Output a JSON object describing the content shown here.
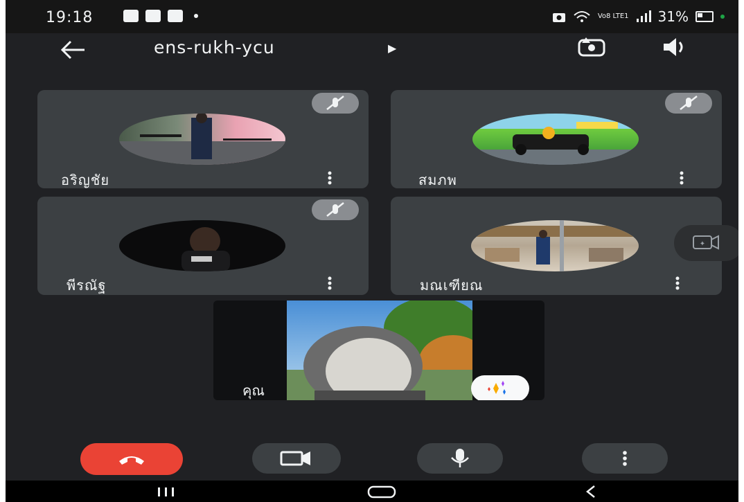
{
  "status_bar": {
    "time": "19:18",
    "right_text": "31%",
    "network": "Vo8 LTE1"
  },
  "top_bar": {
    "meeting_code": "ens-rukh-ycu",
    "back_icon": "arrow-back-icon",
    "switch_camera_icon": "switch-camera-icon",
    "audio_icon": "speaker-icon"
  },
  "participants": [
    {
      "name": "อริญชัย",
      "muted": true
    },
    {
      "name": "สมภพ",
      "muted": true
    },
    {
      "name": "พีรณัฐ",
      "muted": true
    },
    {
      "name": "มณเฑียณ",
      "muted": false
    }
  ],
  "self_view": {
    "label": "คุณ",
    "effects_icon": "sparkle-effects-icon"
  },
  "controls": {
    "end_call_icon": "hang-up-icon",
    "camera_icon": "video-camera-icon",
    "mic_icon": "microphone-icon",
    "more_icon": "more-vert-icon"
  },
  "colors": {
    "background": "#202124",
    "tile": "#3c4043",
    "end_call": "#ea4335",
    "mute_badge": "#8a8d91"
  }
}
